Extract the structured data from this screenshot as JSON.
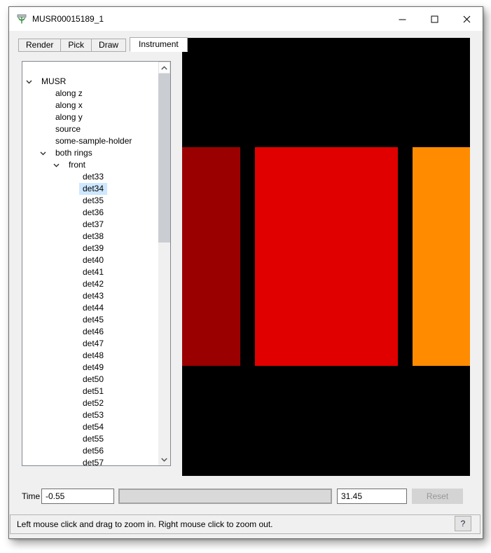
{
  "window": {
    "title": "MUSR00015189_1",
    "icon": "mantid-logo-icon",
    "controls": [
      {
        "name": "minimize"
      },
      {
        "name": "maximize"
      },
      {
        "name": "close"
      }
    ]
  },
  "tabs": [
    {
      "label": "Render",
      "active": false
    },
    {
      "label": "Pick",
      "active": false
    },
    {
      "label": "Draw",
      "active": false
    },
    {
      "label": "Instrument",
      "active": true
    }
  ],
  "tree": {
    "items": [
      {
        "label": "MUSR",
        "level": 0,
        "expanded": true,
        "selected": false
      },
      {
        "label": "along z",
        "level": 1,
        "expanded": false,
        "selected": false
      },
      {
        "label": "along x",
        "level": 1,
        "expanded": false,
        "selected": false
      },
      {
        "label": "along y",
        "level": 1,
        "expanded": false,
        "selected": false
      },
      {
        "label": "source",
        "level": 1,
        "expanded": false,
        "selected": false
      },
      {
        "label": "some-sample-holder",
        "level": 1,
        "expanded": false,
        "selected": false
      },
      {
        "label": "both rings",
        "level": 1,
        "expanded": true,
        "selected": false
      },
      {
        "label": "front",
        "level": 2,
        "expanded": true,
        "selected": false
      },
      {
        "label": "det33",
        "level": 3,
        "expanded": false,
        "selected": false
      },
      {
        "label": "det34",
        "level": 3,
        "expanded": false,
        "selected": true
      },
      {
        "label": "det35",
        "level": 3,
        "expanded": false,
        "selected": false
      },
      {
        "label": "det36",
        "level": 3,
        "expanded": false,
        "selected": false
      },
      {
        "label": "det37",
        "level": 3,
        "expanded": false,
        "selected": false
      },
      {
        "label": "det38",
        "level": 3,
        "expanded": false,
        "selected": false
      },
      {
        "label": "det39",
        "level": 3,
        "expanded": false,
        "selected": false
      },
      {
        "label": "det40",
        "level": 3,
        "expanded": false,
        "selected": false
      },
      {
        "label": "det41",
        "level": 3,
        "expanded": false,
        "selected": false
      },
      {
        "label": "det42",
        "level": 3,
        "expanded": false,
        "selected": false
      },
      {
        "label": "det43",
        "level": 3,
        "expanded": false,
        "selected": false
      },
      {
        "label": "det44",
        "level": 3,
        "expanded": false,
        "selected": false
      },
      {
        "label": "det45",
        "level": 3,
        "expanded": false,
        "selected": false
      },
      {
        "label": "det46",
        "level": 3,
        "expanded": false,
        "selected": false
      },
      {
        "label": "det47",
        "level": 3,
        "expanded": false,
        "selected": false
      },
      {
        "label": "det48",
        "level": 3,
        "expanded": false,
        "selected": false
      },
      {
        "label": "det49",
        "level": 3,
        "expanded": false,
        "selected": false
      },
      {
        "label": "det50",
        "level": 3,
        "expanded": false,
        "selected": false
      },
      {
        "label": "det51",
        "level": 3,
        "expanded": false,
        "selected": false
      },
      {
        "label": "det52",
        "level": 3,
        "expanded": false,
        "selected": false
      },
      {
        "label": "det53",
        "level": 3,
        "expanded": false,
        "selected": false
      },
      {
        "label": "det54",
        "level": 3,
        "expanded": false,
        "selected": false
      },
      {
        "label": "det55",
        "level": 3,
        "expanded": false,
        "selected": false
      },
      {
        "label": "det56",
        "level": 3,
        "expanded": false,
        "selected": false
      },
      {
        "label": "det57",
        "level": 3,
        "expanded": false,
        "selected": false
      }
    ]
  },
  "viewport": {
    "background": "#000000",
    "banks": [
      {
        "name": "detector-bank-left",
        "color": "#9a0000"
      },
      {
        "name": "detector-bank-center",
        "color": "#e00000"
      },
      {
        "name": "detector-bank-right",
        "color": "#ff8c00"
      }
    ]
  },
  "time_controls": {
    "label": "Time",
    "min_value": "-0.55",
    "max_value": "31.45",
    "reset_label": "Reset"
  },
  "status_bar": {
    "message": "Left mouse click and drag to zoom in. Right mouse click to zoom out.",
    "help_button_label": "?"
  }
}
